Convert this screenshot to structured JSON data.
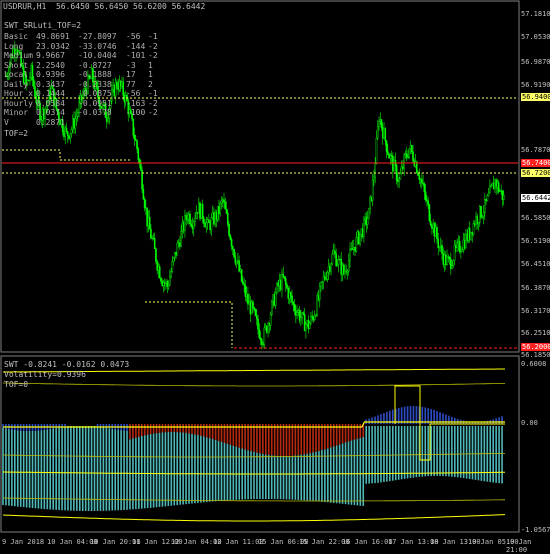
{
  "header": {
    "symbol_line": "USDRUR,H1  56.6450 56.6450 56.6200 56.6442",
    "panel_title": "SWT_SRLuti_TOF=2",
    "tof": "TOF=2"
  },
  "stats": [
    [
      "Basic",
      "49.8691",
      "-27.8097",
      "-56",
      "-1"
    ],
    [
      "Long",
      "23.0342",
      "-33.0746",
      "-144",
      "-2"
    ],
    [
      "Medium",
      "9.9667",
      "-10.0404",
      "-101",
      "-2"
    ],
    [
      "Short",
      "2.2540",
      "-0.8727",
      "-3",
      "1"
    ],
    [
      "Local",
      "0.9396",
      "-0.1888",
      "17",
      "1"
    ],
    [
      "Daily",
      "0.3437",
      "-0.2338",
      "77",
      "2"
    ],
    [
      "Hour x",
      "0.1444",
      "-0.0875",
      "-56",
      "-1"
    ],
    [
      "Hourly",
      "0.0584",
      "-0.0951",
      "-163",
      "-2"
    ],
    [
      "Minor",
      "0.0374",
      "-0.0378",
      "-100",
      "-2"
    ],
    [
      "V",
      "0.2871",
      "",
      "",
      ""
    ]
  ],
  "price_axis": [
    "57.1810",
    "57.0530",
    "56.9870",
    "56.9190",
    "56.7870",
    "56.6442",
    "56.5850",
    "56.5190",
    "56.4510",
    "56.3870",
    "56.3170",
    "56.2510",
    "56.1850"
  ],
  "price_tags": {
    "level_1": "56.9400",
    "level_2": "56.7400",
    "level_3": "56.7200",
    "current": "56.6442",
    "level_4": "56.2000"
  },
  "indicator": {
    "title": "SWT -0.8241 -0.0162 0.0473",
    "volatility": "Volatility=0.9396",
    "tof": "TOF=0",
    "axis": [
      "0.6008",
      "0.00",
      "-1.0567"
    ]
  },
  "time_axis": [
    "9 Jan 2018",
    "10 Jan 04:00",
    "10 Jan 20:00",
    "11 Jan 12:00",
    "12 Jan 04:00",
    "12 Jan 11:00",
    "15 Jan 06:00",
    "15 Jan 22:00",
    "16 Jan 16:00",
    "17 Jan 13:00",
    "18 Jan 13:00",
    "18 Jan 21:00",
    "19 Jan 05:00",
    "19 Jan 21:00"
  ],
  "colors": {
    "background": "#000000",
    "candle": "#00ff00",
    "level_red": "#ff2020",
    "level_yellow": "#ffff66",
    "hist_teal": "#4fb8b8",
    "hist_blue": "#2e4cc8",
    "hist_red": "#b82a10",
    "indicator_line": "#ffff00",
    "grid": "#404040"
  },
  "chart_data": {
    "type": "candlestick",
    "instrument": "USDRUR",
    "timeframe": "H1",
    "ohlc_last": {
      "open": 56.645,
      "high": 56.645,
      "low": 56.62,
      "close": 56.6442
    },
    "close_series": [
      57.02,
      57.08,
      57.12,
      57.05,
      56.99,
      57.03,
      56.95,
      56.9,
      56.93,
      56.98,
      56.92,
      56.88,
      56.84,
      56.86,
      56.9,
      56.95,
      56.99,
      57.02,
      56.97,
      56.93,
      56.9,
      56.96,
      57.0,
      56.98,
      56.94,
      56.87,
      56.8,
      56.7,
      56.58,
      56.52,
      56.45,
      56.4,
      56.38,
      56.44,
      56.5,
      56.55,
      56.6,
      56.58,
      56.62,
      56.6,
      56.56,
      56.58,
      56.6,
      56.64,
      56.57,
      56.5,
      56.44,
      56.38,
      56.33,
      56.3,
      56.25,
      56.22,
      56.27,
      56.33,
      56.38,
      56.4,
      56.36,
      56.32,
      56.3,
      56.27,
      56.26,
      56.29,
      56.34,
      56.4,
      56.44,
      56.48,
      56.45,
      56.42,
      56.46,
      56.5,
      56.53,
      56.56,
      56.6,
      56.72,
      56.9,
      56.84,
      56.78,
      56.74,
      56.7,
      56.76,
      56.8,
      56.77,
      56.72,
      56.66,
      56.6,
      56.55,
      56.5,
      56.46,
      56.45,
      56.48,
      56.5,
      56.52,
      56.54,
      56.58,
      56.6,
      56.62,
      56.66,
      56.7,
      56.67,
      56.64
    ],
    "levels": [
      56.94,
      56.74,
      56.72,
      56.2
    ]
  }
}
